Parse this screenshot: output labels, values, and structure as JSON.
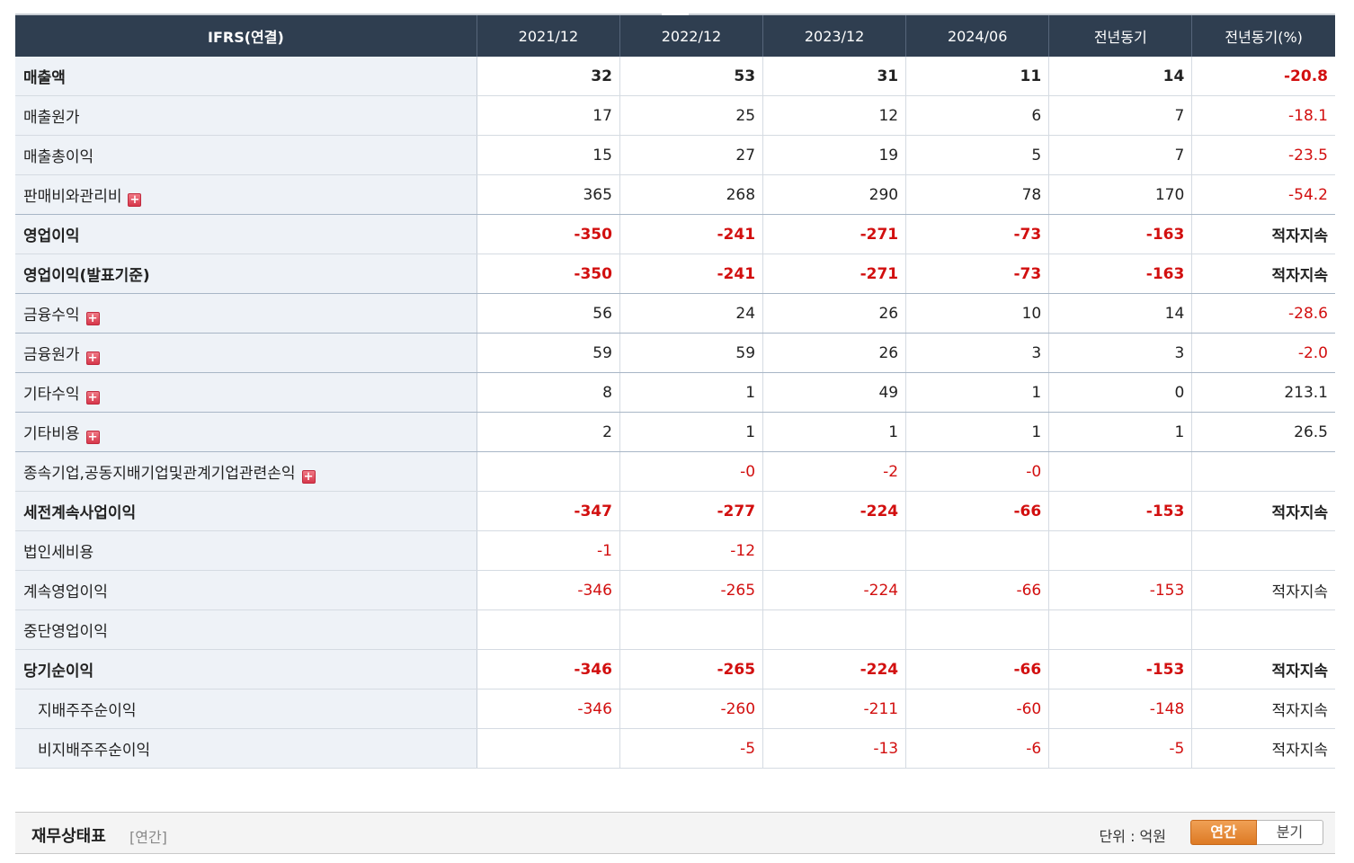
{
  "table": {
    "header": [
      "IFRS(연결)",
      "2021/12",
      "2022/12",
      "2023/12",
      "2024/06",
      "전년동기",
      "전년동기(%)"
    ],
    "rows": [
      {
        "label": "매출액",
        "bold": true,
        "expand": false,
        "sub": false,
        "values": [
          "32",
          "53",
          "31",
          "11",
          "14",
          "-20.8"
        ]
      },
      {
        "label": "매출원가",
        "bold": false,
        "expand": false,
        "sub": false,
        "values": [
          "17",
          "25",
          "12",
          "6",
          "7",
          "-18.1"
        ]
      },
      {
        "label": "매출총이익",
        "bold": false,
        "expand": false,
        "sub": false,
        "values": [
          "15",
          "27",
          "19",
          "5",
          "7",
          "-23.5"
        ]
      },
      {
        "label": "판매비와관리비",
        "bold": false,
        "expand": true,
        "sub": false,
        "values": [
          "365",
          "268",
          "290",
          "78",
          "170",
          "-54.2"
        ]
      },
      {
        "label": "영업이익",
        "bold": true,
        "expand": false,
        "sub": false,
        "values": [
          "-350",
          "-241",
          "-271",
          "-73",
          "-163",
          "적자지속"
        ]
      },
      {
        "label": "영업이익(발표기준)",
        "bold": true,
        "expand": false,
        "sub": false,
        "values": [
          "-350",
          "-241",
          "-271",
          "-73",
          "-163",
          "적자지속"
        ]
      },
      {
        "label": "금융수익",
        "bold": false,
        "expand": true,
        "sub": false,
        "values": [
          "56",
          "24",
          "26",
          "10",
          "14",
          "-28.6"
        ]
      },
      {
        "label": "금융원가",
        "bold": false,
        "expand": true,
        "sub": false,
        "values": [
          "59",
          "59",
          "26",
          "3",
          "3",
          "-2.0"
        ]
      },
      {
        "label": "기타수익",
        "bold": false,
        "expand": true,
        "sub": false,
        "values": [
          "8",
          "1",
          "49",
          "1",
          "0",
          "213.1"
        ]
      },
      {
        "label": "기타비용",
        "bold": false,
        "expand": true,
        "sub": false,
        "values": [
          "2",
          "1",
          "1",
          "1",
          "1",
          "26.5"
        ]
      },
      {
        "label": "종속기업,공동지배기업및관계기업관련손익",
        "bold": false,
        "expand": true,
        "sub": false,
        "values": [
          "",
          "-0",
          "-2",
          "-0",
          "",
          ""
        ]
      },
      {
        "label": "세전계속사업이익",
        "bold": true,
        "expand": false,
        "sub": false,
        "values": [
          "-347",
          "-277",
          "-224",
          "-66",
          "-153",
          "적자지속"
        ]
      },
      {
        "label": "법인세비용",
        "bold": false,
        "expand": false,
        "sub": false,
        "values": [
          "-1",
          "-12",
          "",
          "",
          "",
          ""
        ]
      },
      {
        "label": "계속영업이익",
        "bold": false,
        "expand": false,
        "sub": false,
        "values": [
          "-346",
          "-265",
          "-224",
          "-66",
          "-153",
          "적자지속"
        ]
      },
      {
        "label": "중단영업이익",
        "bold": false,
        "expand": false,
        "sub": false,
        "values": [
          "",
          "",
          "",
          "",
          "",
          ""
        ]
      },
      {
        "label": "당기순이익",
        "bold": true,
        "expand": false,
        "sub": false,
        "values": [
          "-346",
          "-265",
          "-224",
          "-66",
          "-153",
          "적자지속"
        ]
      },
      {
        "label": "지배주주순이익",
        "bold": false,
        "expand": false,
        "sub": true,
        "values": [
          "-346",
          "-260",
          "-211",
          "-60",
          "-148",
          "적자지속"
        ]
      },
      {
        "label": "비지배주주순이익",
        "bold": false,
        "expand": false,
        "sub": true,
        "values": [
          "",
          "-5",
          "-13",
          "-6",
          "-5",
          "적자지속"
        ]
      }
    ]
  },
  "section": {
    "title": "재무상태표",
    "subtitle": "[연간]",
    "unit": "단위 : 억원",
    "toggle": [
      "연간",
      "분기"
    ],
    "active": "연간"
  },
  "colors": {
    "header_bg": "#2f3e50",
    "negative": "#d20f0f",
    "label_bg": "#eef2f7",
    "toggle_active": "#e08a35"
  },
  "icons": {
    "expand": "plus-icon"
  }
}
